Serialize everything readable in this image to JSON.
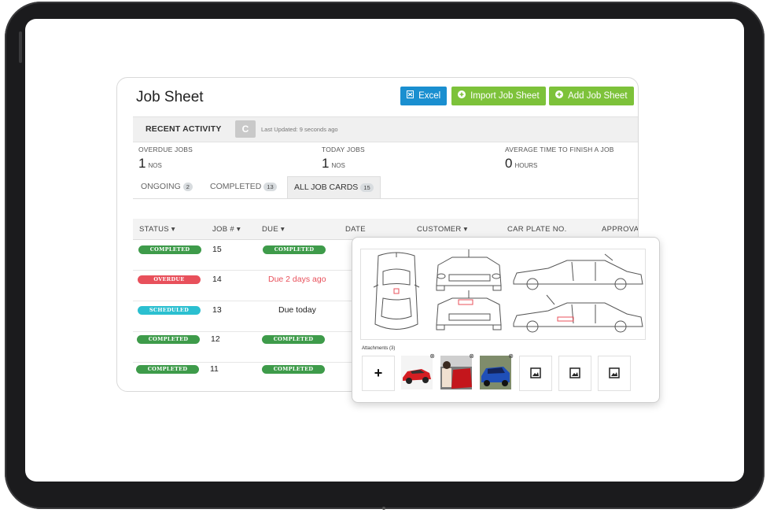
{
  "header": {
    "title": "Job Sheet",
    "buttons": [
      {
        "label": "Excel",
        "icon": "excel-icon",
        "color": "#1a8fd0"
      },
      {
        "label": "Import Job Sheet",
        "icon": "plus-circle-icon",
        "color": "#7dc23a"
      },
      {
        "label": "Add Job Sheet",
        "icon": "plus-circle-icon",
        "color": "#7dc23a"
      }
    ]
  },
  "activity": {
    "label": "RECENT ACTIVITY",
    "refresh_icon": "C",
    "updated": "Last Updated: 9 seconds ago"
  },
  "stats": [
    {
      "label": "OVERDUE JOBS",
      "value": "1",
      "unit": "NOS"
    },
    {
      "label": "TODAY JOBS",
      "value": "1",
      "unit": "NOS"
    },
    {
      "label": "AVERAGE TIME TO FINISH A JOB",
      "value": "0",
      "unit": "HOURS"
    }
  ],
  "tabs": [
    {
      "label": "ONGOING",
      "count": "2"
    },
    {
      "label": "COMPLETED",
      "count": "13"
    },
    {
      "label": "ALL JOB CARDS",
      "count": "15"
    }
  ],
  "table": {
    "columns": [
      "STATUS ▾",
      "JOB # ▾",
      "DUE ▾",
      "DATE",
      "CUSTOMER ▾",
      "CAR PLATE NO.",
      "APPROVAL"
    ],
    "rows": [
      {
        "status": "COMPLETED",
        "job": "15",
        "due": "COMPLETED"
      },
      {
        "status": "OVERDUE",
        "job": "14",
        "due": "Due 2 days ago"
      },
      {
        "status": "SCHEDULED",
        "job": "13",
        "due": "Due today"
      },
      {
        "status": "COMPLETED",
        "job": "12",
        "due": "COMPLETED"
      },
      {
        "status": "COMPLETED",
        "job": "11",
        "due": "COMPLETED"
      }
    ]
  },
  "colors": {
    "completed": "#3e9b4a",
    "overdue": "#e8505b",
    "scheduled": "#2bbfd0",
    "overdue_text": "#e8505b"
  },
  "overlay": {
    "attachments_label": "Attachments (3)",
    "add_icon": "+",
    "thumbnails": [
      "red-car-photo",
      "red-car-interior-photo",
      "blue-car-photo"
    ],
    "placeholders": [
      "image-icon",
      "image-icon",
      "image-icon"
    ]
  }
}
